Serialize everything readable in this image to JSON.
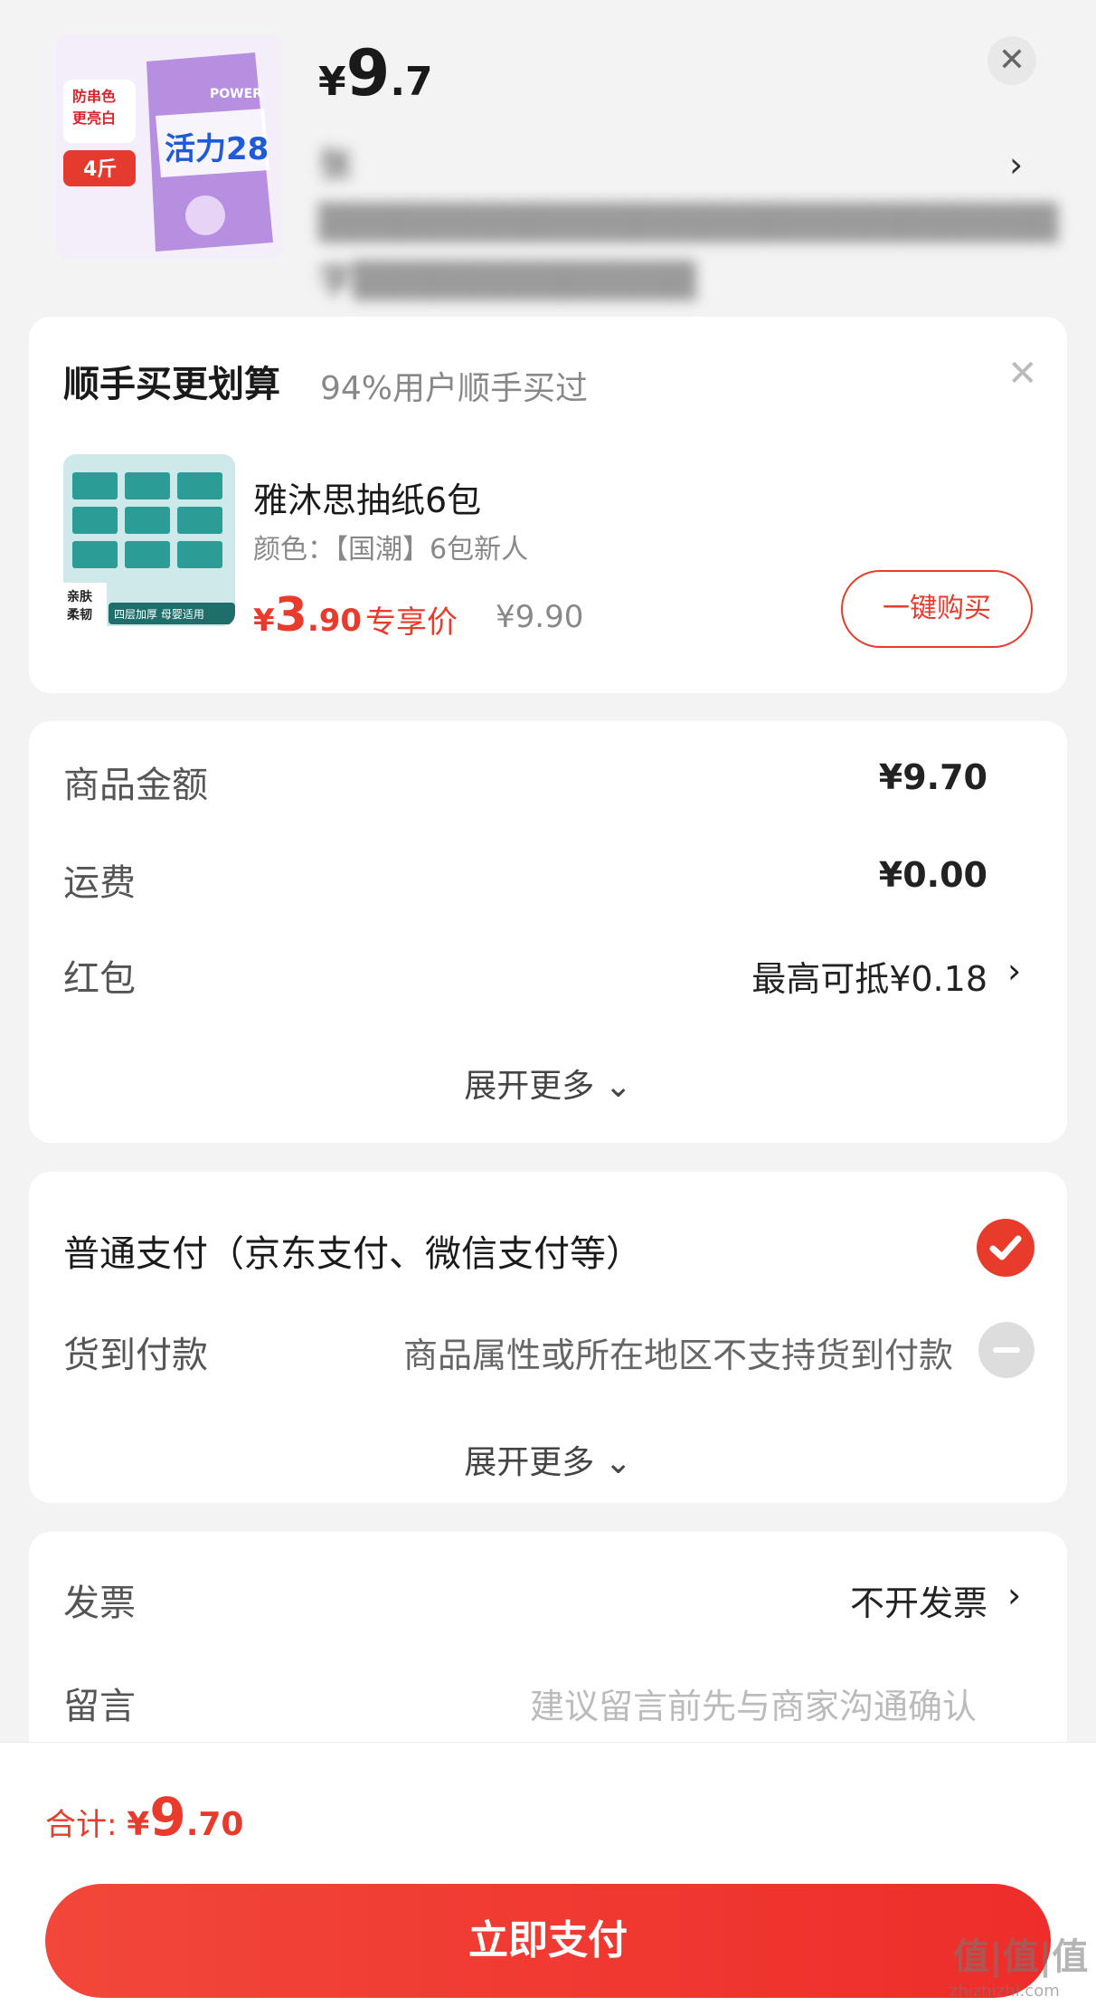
{
  "product": {
    "price_symbol": "¥",
    "price_int": "9",
    "price_dec": ".7",
    "title_line1": "张▒▒▒▒▒▒▒▒▒▒▒▒▒▒▒▒▒▒▒▒▒▒▒▒▒▒▒▒",
    "title_line2": "字▒▒▒▒▒▒▒▒▒▒▒▒▒",
    "thumb_texts": [
      "防串色",
      "更亮白",
      "4斤",
      "活力28",
      "POWER"
    ]
  },
  "upsell": {
    "title": "顺手买更划算",
    "subtitle": "94%用户顺手买过",
    "item_name": "雅沐思抽纸6包",
    "item_spec": "颜色：【国潮】6包新人",
    "price_symbol": "¥",
    "price_int": "3",
    "price_dec": ".90",
    "exclusive_label": "专享价",
    "original_price": "¥9.90",
    "buy_label": "一键购买",
    "img_texts": [
      "亲肤",
      "柔韧",
      "四层加厚 母婴适用"
    ]
  },
  "amounts": {
    "rows": [
      {
        "label": "商品金额",
        "value": "¥9.70"
      },
      {
        "label": "运费",
        "value": "¥0.00"
      },
      {
        "label": "红包",
        "value": "最高可抵¥0.18"
      }
    ],
    "expand_label": "展开更多 ⌄"
  },
  "payment": {
    "normal_label": "普通支付（京东支付、微信支付等）",
    "cod_label": "货到付款",
    "cod_note": "商品属性或所在地区不支持货到付款",
    "expand_label": "展开更多 ⌄"
  },
  "invoice": {
    "label": "发票",
    "value": "不开发票",
    "message_label": "留言",
    "message_placeholder": "建议留言前先与商家沟通确认"
  },
  "footer": {
    "total_label": "合计: ",
    "price_symbol": "¥",
    "price_int": "9",
    "price_dec": ".70",
    "pay_button": "立即支付"
  },
  "watermark": {
    "main": "值|值|值",
    "sub": "zhizhizhi.com"
  },
  "colors": {
    "accent": "#e93b2c",
    "background": "#f3f3f3"
  }
}
